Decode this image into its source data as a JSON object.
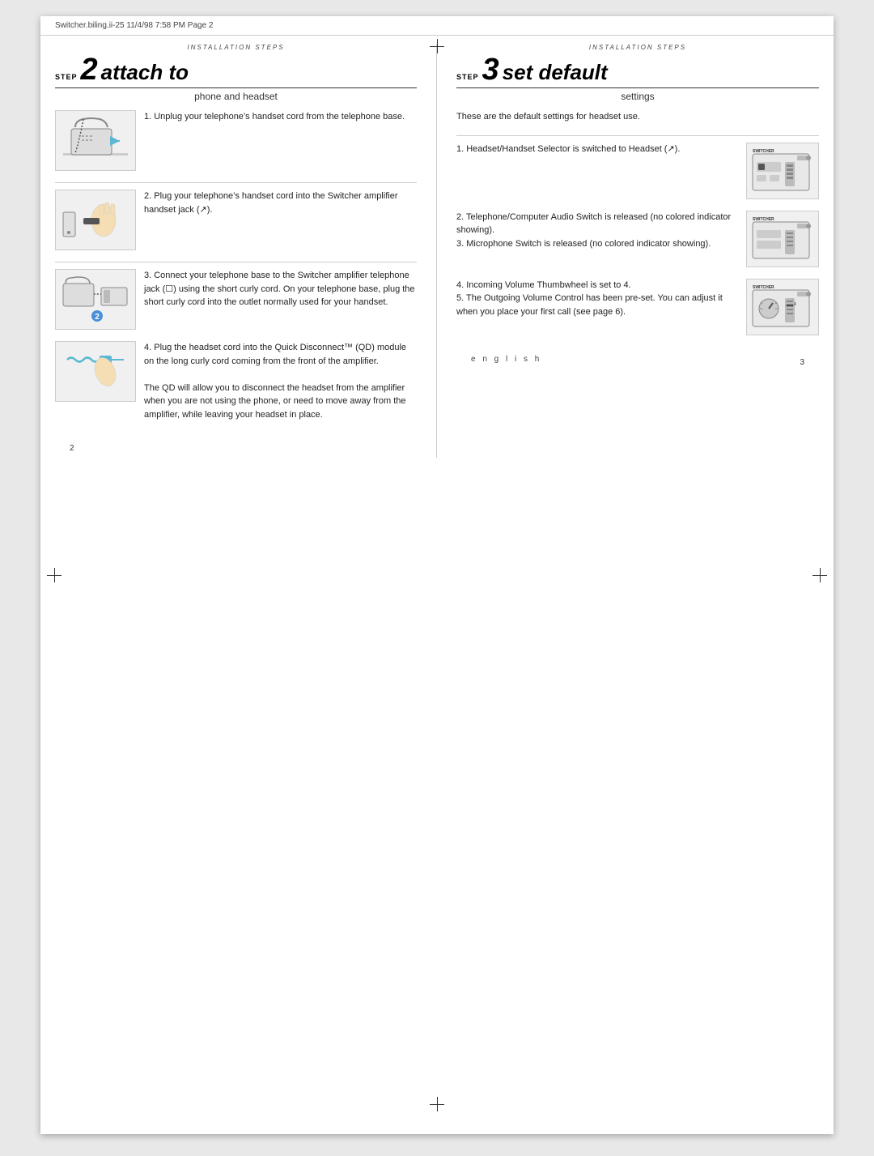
{
  "header": {
    "left_text": "Switcher.biling.ii-25   11/4/98  7:58 PM   Page 2"
  },
  "left_column": {
    "section_label": "INSTALLATION STEPS",
    "step_number": "2",
    "step_text": "attach to",
    "step_subtitle": "phone and headset",
    "instructions": [
      {
        "id": 1,
        "has_image": true,
        "image_type": "phone_on_desk",
        "text": "1. Unplug your telephone’s handset cord from the telephone base."
      },
      {
        "id": 2,
        "has_image": true,
        "image_type": "plugging_cord",
        "text": "2. Plug your telephone’s handset cord into the Switcher amplifier handset jack (↗)."
      },
      {
        "id": 3,
        "has_image": true,
        "image_type": "phone_with_device",
        "text": "3. Connect your telephone base to the Switcher amplifier telephone jack (☐) using the short curly cord. On your telephone base, plug the short curly cord into the outlet normally used for your handset."
      },
      {
        "id": 4,
        "has_image": true,
        "image_type": "headset_cord",
        "text": "4. Plug the headset cord into the Quick Disconnect™ (QD) module on the long curly cord coming from the front of the amplifier.\n\nThe QD will allow you to disconnect the headset from the amplifier when you are not using the phone, or need to move away from the amplifier, while leaving your headset in place."
      }
    ],
    "page_number": "2"
  },
  "right_column": {
    "section_label": "INSTALLATION STEPS",
    "step_number": "3",
    "step_text": "set default",
    "step_subtitle": "settings",
    "intro_text": "These are the default settings for headset use.",
    "instructions": [
      {
        "id": 1,
        "has_image": true,
        "image_type": "device_top",
        "text": "1. Headset/Handset Selector is switched to Headset (↗)."
      },
      {
        "id": 2,
        "has_image": true,
        "image_type": "device_middle",
        "text": "2. Telephone/Computer Audio Switch is released (no colored indicator showing).\n3. Microphone Switch is released (no colored indicator showing)."
      },
      {
        "id": 4,
        "has_image": true,
        "image_type": "device_bottom",
        "text": "4. Incoming Volume Thumbwheel is set to 4.\n5. The Outgoing Volume Control has been pre-set. You can adjust it when you place your first call (see page 6)."
      }
    ],
    "page_number": "3",
    "english_label": "e n g l i s h"
  }
}
